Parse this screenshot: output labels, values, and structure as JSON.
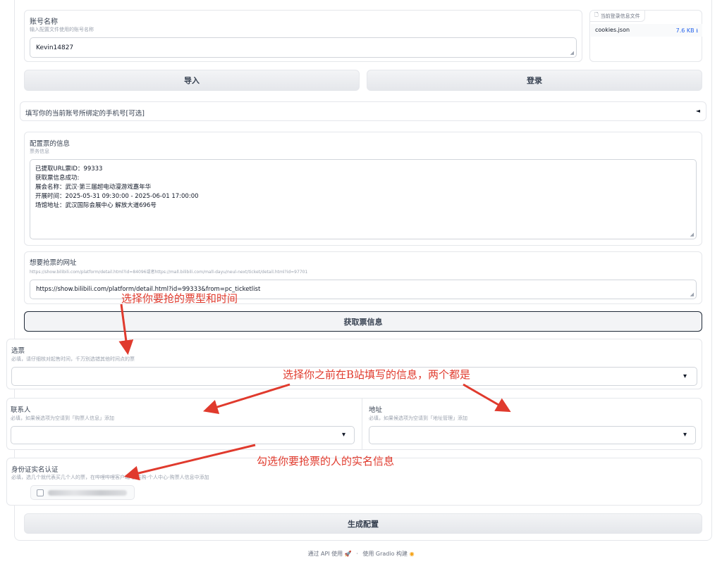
{
  "account": {
    "label": "账号名称",
    "info": "输入配置文件使用的账号名称",
    "value": "Kevin14827"
  },
  "login_file": {
    "label": "当前登录信息文件",
    "filename": "cookies.json",
    "size": "7.6 KB ⭳"
  },
  "buttons": {
    "import": "导入",
    "login": "登录",
    "fetch": "获取票信息",
    "generate": "生成配置"
  },
  "phone_accordion": {
    "label": "填写你的当前账号所绑定的手机号[可选]",
    "caret": "◄"
  },
  "ticket_info": {
    "label": "配置票的信息",
    "info": "票务信息",
    "lines": [
      "已提取URL票ID：99333",
      "获取票信息成功:",
      "展会名称：武汉·第三届超电动漫游戏嘉年华",
      "开展时间：2025-05-31 09:30:00 - 2025-06-01 17:00:00",
      "场馆地址：武汉国际会展中心 解放大道696号"
    ]
  },
  "url": {
    "label": "想要抢票的网址",
    "info": "https://show.bilibili.com/platform/detail.html?id=84096或者https://mall.bilibili.com/mall-dayu/neul-next/ticket/detail.html?id=97701",
    "value": "https://show.bilibili.com/platform/detail.html?id=99333&from=pc_ticketlist"
  },
  "ticket_select": {
    "label": "选票",
    "info": "必填，请仔细核对起售时间，千万别选错其他时间点的票",
    "caret": "▾"
  },
  "contact": {
    "label": "联系人",
    "info": "必填，如果候选项为空请到「购票人信息」添加",
    "caret": "▾"
  },
  "address": {
    "label": "地址",
    "info": "必填，如果候选项为空请到「地址管理」添加",
    "caret": "▾"
  },
  "id_verify": {
    "label": "身份证实名认证",
    "info": "必填，选几个就代表买几个人的票，在哔哩哔哩客户端-会员购-个人中心-购票人信息中添加"
  },
  "annotations": {
    "a1": "选择你要抢的票型和时间",
    "a2": "选择你之前在B站填写的信息，两个都是",
    "a3": "勾选你要抢票的人的实名信息"
  },
  "footer": {
    "api": "通过 API 使用",
    "sep": "·",
    "built": "使用 Gradio 构建"
  },
  "colors": {
    "annotation_red": "#e03a2d",
    "link_blue": "#2563eb"
  }
}
